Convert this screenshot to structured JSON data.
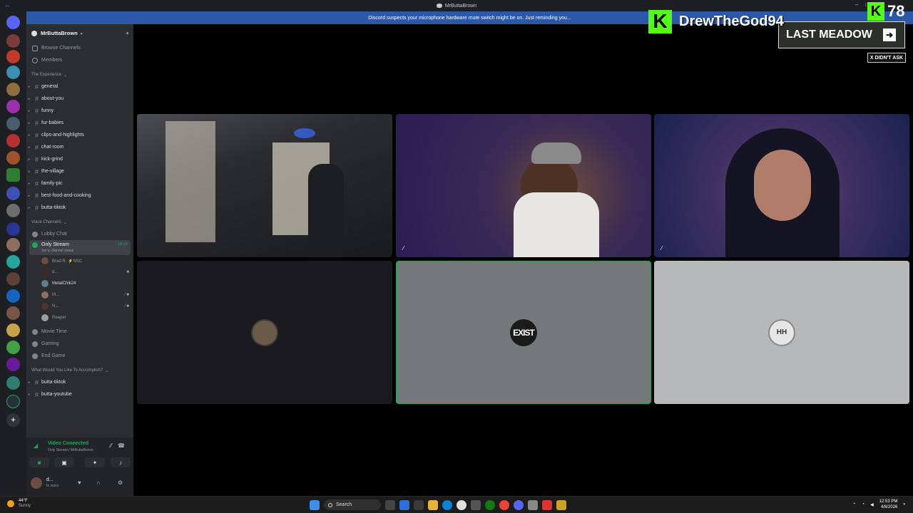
{
  "window": {
    "title": "MrButtaBrown"
  },
  "notice": {
    "text": "Discord suspects your microphone hardware mute switch might be on. Just reminding you..."
  },
  "server": {
    "name": "MrButtaBrown"
  },
  "nav": {
    "browse": "Browse Channels",
    "members": "Members"
  },
  "categories": {
    "experience": "The Experience",
    "voice": "Voice Channels",
    "accomplish": "What Would You Like To Accomplish?"
  },
  "text_channels": [
    {
      "name": "general"
    },
    {
      "name": "about-you"
    },
    {
      "name": "funny"
    },
    {
      "name": "fur-babies"
    },
    {
      "name": "clips-and-highlights"
    },
    {
      "name": "chat-room"
    },
    {
      "name": "kick-grind"
    },
    {
      "name": "the-village"
    },
    {
      "name": "family-pic"
    },
    {
      "name": "best-food-and-cooking"
    },
    {
      "name": "butta-tiktok"
    }
  ],
  "voice_channels": {
    "lobby": "Lobby Chat",
    "only_stream": {
      "name": "Only Stream",
      "time": "18:22",
      "status": "Set a channel status"
    },
    "members": [
      {
        "name": "Brad R. ⚡NSC"
      },
      {
        "name": "d..."
      },
      {
        "name": "MetalChik24"
      },
      {
        "name": "M..."
      },
      {
        "name": "N..."
      },
      {
        "name": "Reaper"
      }
    ],
    "movie": "Movie Time",
    "gaming": "Gaming",
    "end_game": "End Game"
  },
  "accomplish_channels": [
    {
      "name": "butta-tiktok"
    },
    {
      "name": "butta-youtube"
    }
  ],
  "voice_panel": {
    "status": "Video Connected",
    "sub": "Only Stream / MrButtaBrown"
  },
  "user_panel": {
    "name": "d...",
    "status": "In voice"
  },
  "overlay": {
    "kick_name": "DrewTheGod94",
    "meadow": "LAST MEADOW",
    "kick_count": "78",
    "didnt_ask": "X DIDN'T ASK"
  },
  "tiles": {
    "t5_avatar": "EXIST",
    "t6_avatar": "HH"
  },
  "taskbar": {
    "temp": "44°F",
    "weather": "Sunny",
    "search": "Search",
    "time": "12:53 PM",
    "date": "4/8/2026"
  },
  "colors": {
    "accent_green": "#23a55a",
    "kick_green": "#53fc18",
    "notice_blue": "#2b58a8"
  }
}
